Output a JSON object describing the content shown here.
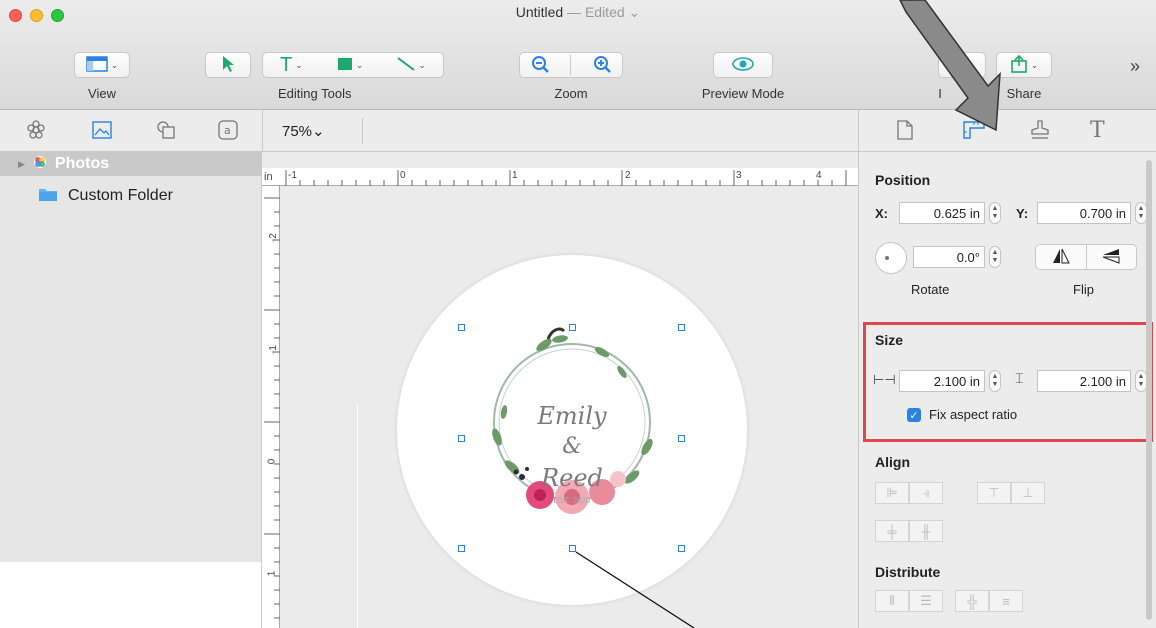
{
  "window": {
    "title": "Untitled",
    "edited": " — Edited ⌄"
  },
  "toolbar": {
    "view_label": "View",
    "editing_tools_label": "Editing Tools",
    "zoom_label": "Zoom",
    "preview_mode_label": "Preview Mode",
    "share_label": "Share",
    "partial_label": "I",
    "overflow": "»"
  },
  "subbar": {
    "zoom_value": "75%⌄"
  },
  "sidebar": {
    "items": [
      {
        "label": "Photos"
      },
      {
        "label": "Custom Folder"
      }
    ]
  },
  "ruler": {
    "unit": "in",
    "h_ticks": [
      "-1",
      "0",
      "1",
      "2",
      "3",
      "4"
    ],
    "v_ticks": [
      "-2",
      "-1",
      "0",
      "1"
    ]
  },
  "design": {
    "line1": "Emily",
    "line2": "&",
    "line3": "Reed",
    "line4": "EST. 2020"
  },
  "inspector": {
    "position_title": "Position",
    "x_label": "X:",
    "x_value": "0.625 in",
    "y_label": "Y:",
    "y_value": "0.700 in",
    "rotate_value": "0.0°",
    "rotate_label": "Rotate",
    "flip_label": "Flip",
    "size_title": "Size",
    "width_value": "2.100 in",
    "height_value": "2.100 in",
    "fix_aspect_label": "Fix aspect ratio",
    "fix_aspect_checked": true,
    "align_title": "Align",
    "distribute_title": "Distribute"
  },
  "colors": {
    "highlight_box": "#e0474c",
    "accent": "#2a82e4",
    "arrow": "#8a8a8a"
  }
}
